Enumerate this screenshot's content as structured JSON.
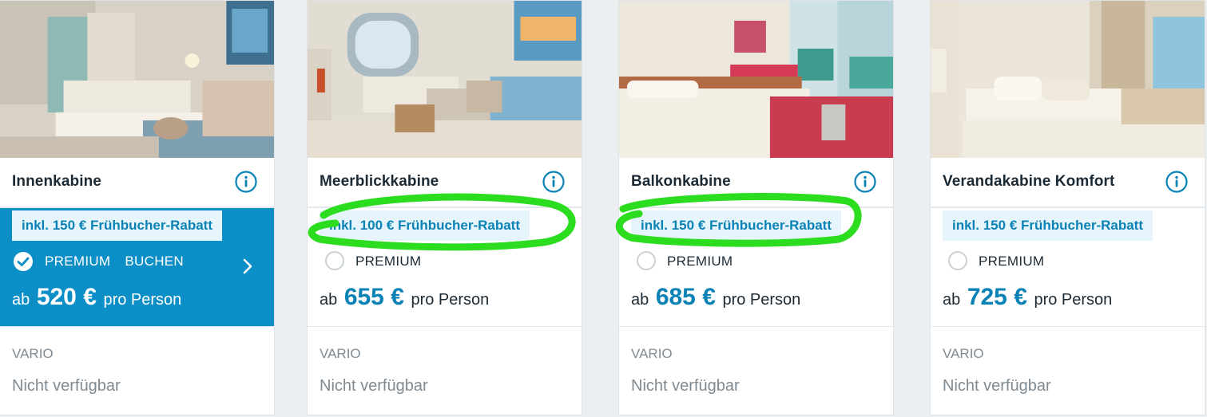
{
  "colors": {
    "accent": "#0a82b6",
    "selected_background": "#0c8ec6",
    "badge_background": "#e6f5fb",
    "muted_text": "#7f8a92",
    "highlight_scribble": "#2bdc1f"
  },
  "cabins": [
    {
      "name": "Innenkabine",
      "discount_badge": "inkl. 150 € Frühbucher-Rabatt",
      "option_label": "PREMIUM  BUCHEN",
      "selected": true,
      "price_prefix": "ab",
      "price": "520 €",
      "price_suffix": "pro Person",
      "vario_label": "VARIO",
      "vario_status": "Nicht verfügbar",
      "icons": [
        "info-icon",
        "checkmark-icon",
        "chevron-right-icon"
      ]
    },
    {
      "name": "Meerblickkabine",
      "discount_badge": "inkl. 100 € Frühbucher-Rabatt",
      "option_label": "PREMIUM",
      "selected": false,
      "price_prefix": "ab",
      "price": "655 €",
      "price_suffix": "pro Person",
      "vario_label": "VARIO",
      "vario_status": "Nicht verfügbar",
      "icons": [
        "info-icon",
        "radio-button-icon"
      ]
    },
    {
      "name": "Balkonkabine",
      "discount_badge": "inkl. 150 € Frühbucher-Rabatt",
      "option_label": "PREMIUM",
      "selected": false,
      "price_prefix": "ab",
      "price": "685 €",
      "price_suffix": "pro Person",
      "vario_label": "VARIO",
      "vario_status": "Nicht verfügbar",
      "icons": [
        "info-icon",
        "radio-button-icon"
      ]
    },
    {
      "name": "Verandakabine Komfort",
      "discount_badge": "inkl. 150 € Frühbucher-Rabatt",
      "option_label": "PREMIUM",
      "selected": false,
      "price_prefix": "ab",
      "price": "725 €",
      "price_suffix": "pro Person",
      "vario_label": "VARIO",
      "vario_status": "Nicht verfügbar",
      "icons": [
        "info-icon",
        "radio-button-icon"
      ]
    }
  ]
}
